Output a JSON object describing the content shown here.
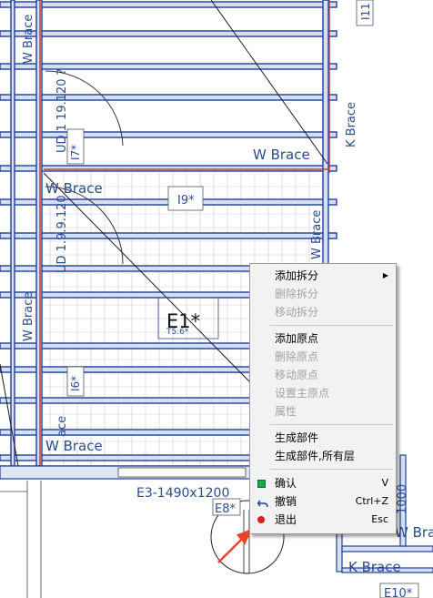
{
  "drawing": {
    "brace_labels": {
      "top_right": "W Brace",
      "mid_left": "W Brace",
      "bottom_left": "W Brace",
      "bottom_right": "W Bra",
      "k_top_right": "K Brace",
      "k_bottom": "K Brace",
      "v_left_top": "W Brace",
      "v_left_mid": "W Brace",
      "v_left_low": "ace",
      "v_right_mid": "W Brace"
    },
    "dims": {
      "v1": "UD 1 19.120 ?",
      "v2": "UD 1.9.9.120",
      "v3": "1000"
    },
    "tags": {
      "t17": "I7*",
      "t19": "I9*",
      "t16": "I6*",
      "t11": "I11",
      "e8": "E8*",
      "e10": "E10*",
      "e_center": "E1*",
      "e_center_sub": "T5.6*"
    },
    "window_label": "E3-1490x1200"
  },
  "context_menu": {
    "items": [
      {
        "label": "添加拆分",
        "enabled": true,
        "submenu": true
      },
      {
        "label": "删除拆分",
        "enabled": false
      },
      {
        "label": "移动拆分",
        "enabled": false
      },
      {
        "label": "添加原点",
        "enabled": true
      },
      {
        "label": "删除原点",
        "enabled": false
      },
      {
        "label": "移动原点",
        "enabled": false
      },
      {
        "label": "设置主原点",
        "enabled": false
      },
      {
        "label": "属性",
        "enabled": false
      },
      {
        "label": "生成部件",
        "enabled": true
      },
      {
        "label": "生成部件,所有层",
        "enabled": true
      },
      {
        "label": "确认",
        "enabled": true,
        "shortcut": "V",
        "icon": "green-square-icon"
      },
      {
        "label": "撤销",
        "enabled": true,
        "shortcut": "Ctrl+Z",
        "icon": "undo-arrow-icon"
      },
      {
        "label": "退出",
        "enabled": true,
        "shortcut": "Esc",
        "icon": "red-circle-icon"
      }
    ]
  },
  "colors": {
    "beam_fill": "#d6e0f0",
    "beam_edge": "#1f3f9a",
    "red_line": "#c83a3a",
    "annotation_arrow": "#e8442a",
    "dim_text": "#2a4d8f"
  }
}
